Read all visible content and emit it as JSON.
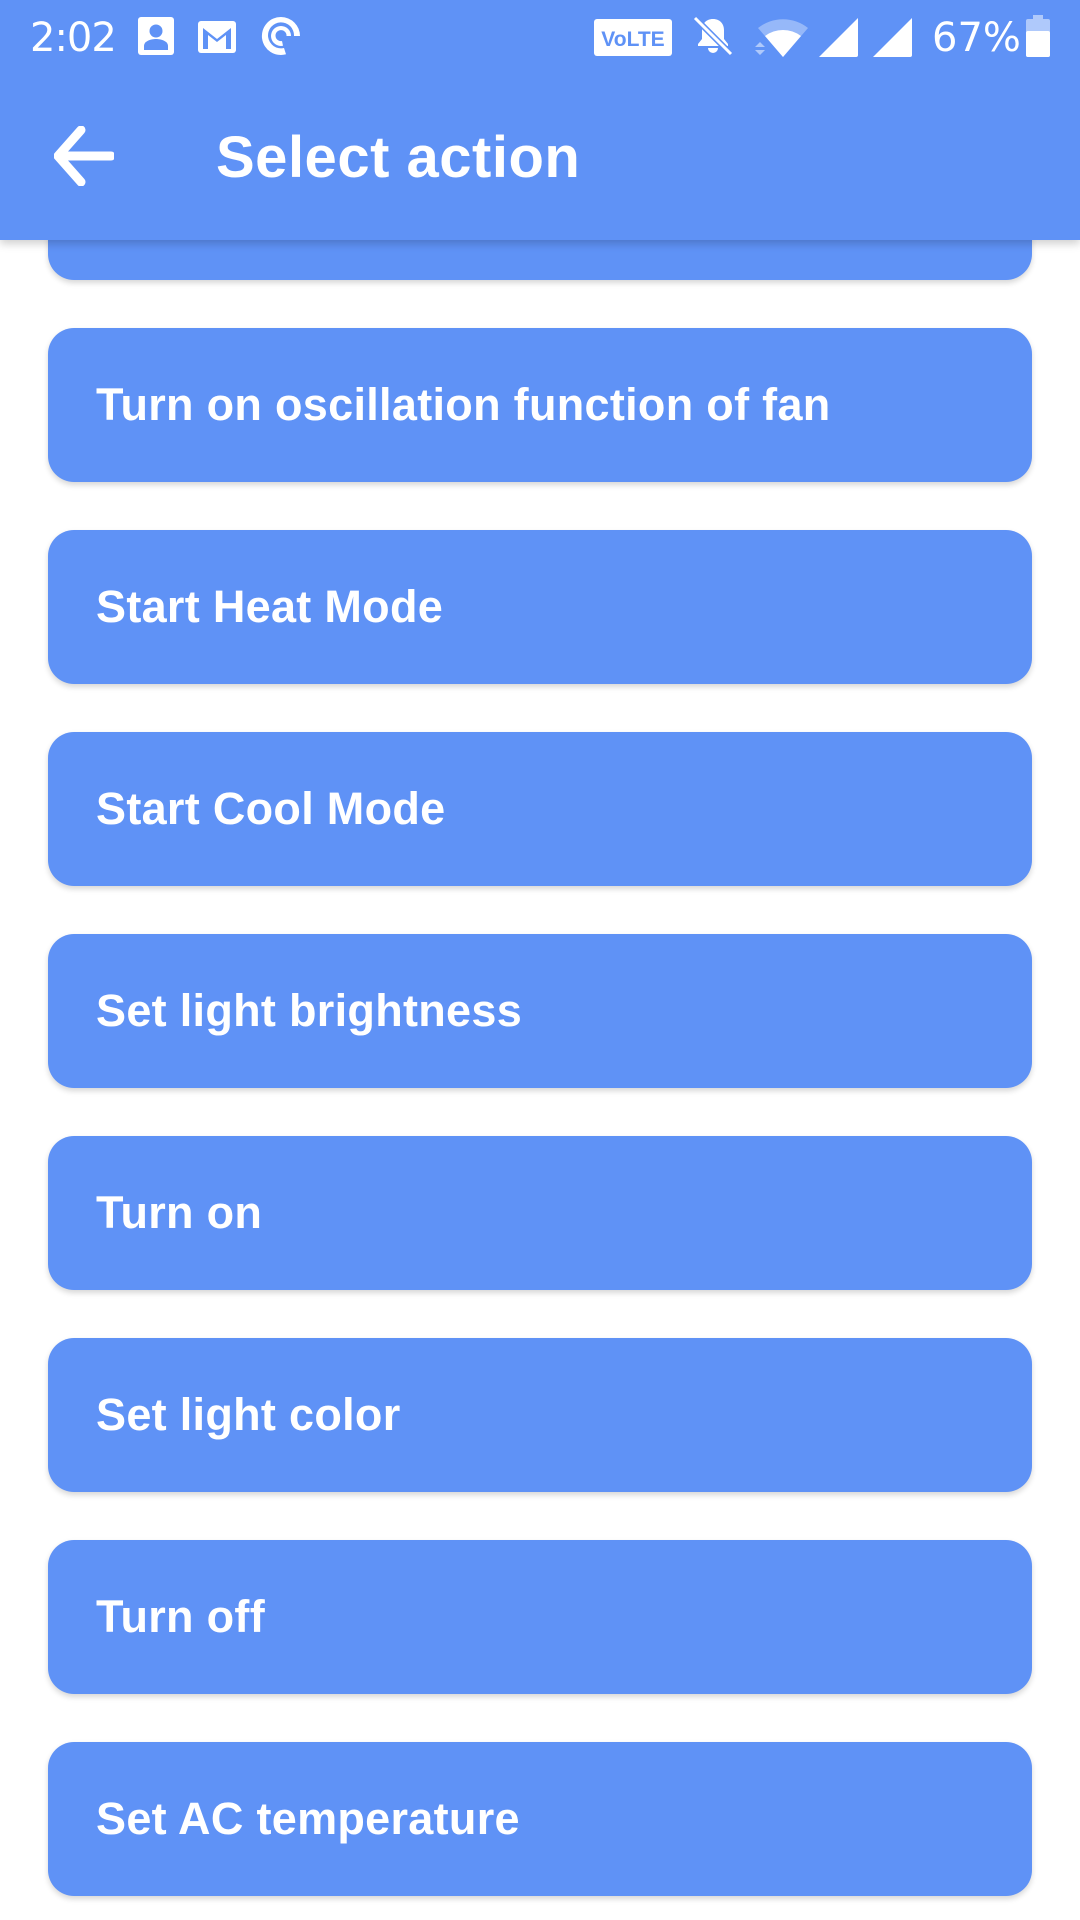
{
  "status_bar": {
    "time": "2:02",
    "notification_icons": [
      "contacts-icon",
      "gmail-icon",
      "pocket-casts-icon"
    ],
    "system_icons": [
      "volte-icon",
      "notifications-muted-icon",
      "wifi-icon",
      "signal-icon",
      "signal-icon"
    ],
    "volte_label": "VoLTE",
    "battery_percent": "67%",
    "battery_level": 0.67
  },
  "app_bar": {
    "back_icon": "arrow-left-icon",
    "title": "Select action"
  },
  "theme": {
    "accent": "#5F92F6",
    "background": "#FFFFFF",
    "text_on_accent": "#FFFFFF"
  },
  "actions": [
    {
      "label": ""
    },
    {
      "label": "Turn on oscillation function of fan"
    },
    {
      "label": "Start Heat Mode"
    },
    {
      "label": "Start Cool Mode"
    },
    {
      "label": "Set light brightness"
    },
    {
      "label": "Turn on"
    },
    {
      "label": "Set light color"
    },
    {
      "label": "Turn off"
    },
    {
      "label": "Set AC temperature"
    }
  ]
}
